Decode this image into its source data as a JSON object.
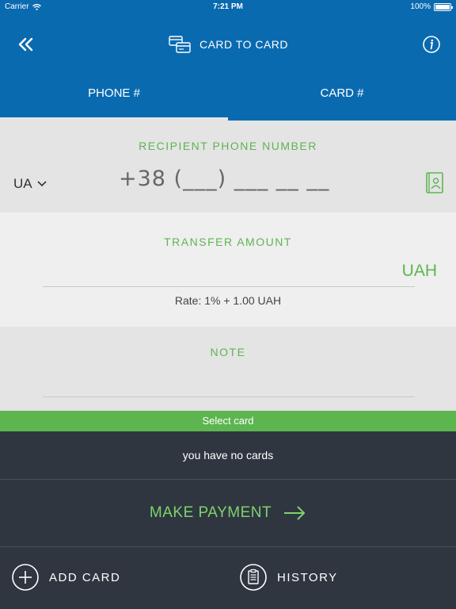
{
  "status_bar": {
    "carrier": "Carrier",
    "time": "7:21 PM",
    "battery": "100%",
    "battery_level": 1.0
  },
  "header": {
    "title": "CARD TO CARD",
    "back_icon": "double-chevron-left-icon",
    "info_icon": "info-icon",
    "title_icon": "card-transfer-icon"
  },
  "tabs": [
    {
      "label": "PHONE #",
      "active": true
    },
    {
      "label": "CARD #",
      "active": false
    }
  ],
  "recipient": {
    "title": "RECIPIENT PHONE NUMBER",
    "country": "UA",
    "phone_mask": "+38 (___) ___ __ __",
    "contacts_icon": "contact-book-icon"
  },
  "amount": {
    "title": "TRANSFER AMOUNT",
    "value": "",
    "currency": "UAH",
    "rate": "Rate: 1% + 1.00 UAH"
  },
  "note": {
    "title": "NOTE",
    "value": ""
  },
  "cards": {
    "select_label": "Select card",
    "empty_text": "you have no cards"
  },
  "actions": {
    "make_payment": "MAKE PAYMENT",
    "add_card": "ADD CARD",
    "history": "HISTORY"
  },
  "colors": {
    "header_blue": "#0a6ab0",
    "accent_green": "#5db550",
    "payment_green": "#7ed36d",
    "dark_panel": "#2f3640"
  }
}
